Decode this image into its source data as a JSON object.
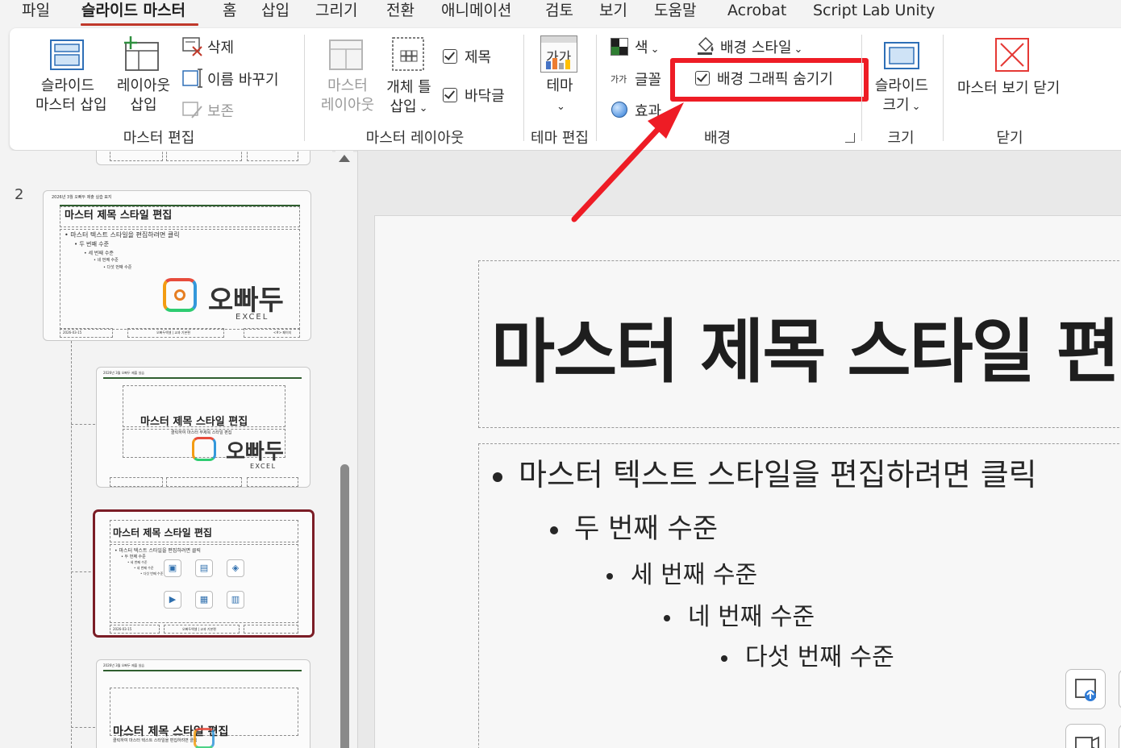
{
  "menu": {
    "tabs": [
      {
        "label": "파일",
        "active": false
      },
      {
        "label": "슬라이드 마스터",
        "active": true
      },
      {
        "label": "홈",
        "active": false
      },
      {
        "label": "삽입",
        "active": false
      },
      {
        "label": "그리기",
        "active": false
      },
      {
        "label": "전환",
        "active": false
      },
      {
        "label": "애니메이션",
        "active": false
      },
      {
        "label": "검토",
        "active": false
      },
      {
        "label": "보기",
        "active": false
      },
      {
        "label": "도움말",
        "active": false
      },
      {
        "label": "Acrobat",
        "active": false
      },
      {
        "label": "Script Lab Unity",
        "active": false
      }
    ],
    "active_underline_color": "#c0392b"
  },
  "ribbon": {
    "master_edit": {
      "insert_master_line1": "슬라이드",
      "insert_master_line2": "마스터 삽입",
      "insert_layout_line1": "레이아웃",
      "insert_layout_line2": "삽입",
      "delete": "삭제",
      "rename": "이름 바꾸기",
      "preserve": "보존",
      "group_label": "마스터 편집"
    },
    "master_layout": {
      "master_layout_line1": "마스터",
      "master_layout_line2": "레이아웃",
      "placeholder_line1": "개체 틀",
      "placeholder_line2": "삽입",
      "title_check": "제목",
      "footer_check": "바닥글",
      "group_label": "마스터 레이아웃",
      "title_checked": true,
      "footer_checked": true
    },
    "theme_edit": {
      "theme_icon_text": "가가",
      "theme": "테마",
      "group_label": "테마 편집"
    },
    "background": {
      "colors": "색",
      "fonts_icon_text": "가가",
      "fonts": "글꼴",
      "effects": "효과",
      "background_styles": "배경 스타일",
      "hide_background_graphics": "배경 그래픽 숨기기",
      "hide_background_graphics_checked": true,
      "group_label": "배경"
    },
    "size": {
      "slide_size_line1": "슬라이드",
      "slide_size_line2": "크기",
      "group_label": "크기"
    },
    "close": {
      "close_master_view": "마스터 보기 닫기",
      "group_label": "닫기"
    }
  },
  "annotation": {
    "highlight_color": "#ee1c25"
  },
  "thumbnails": {
    "slide_number": "2",
    "master": {
      "header_tiny": "2026년 3월 오빠두 제출 실습 표지",
      "title": "마스터 제목 스타일 편집",
      "bullets": [
        "• 마스터 텍스트 스타일을 편집하려면 클릭",
        "• 두 번째 수준",
        "• 세 번째 수준",
        "• 네 번째 수준",
        "• 다섯 번째 수준"
      ],
      "logo_text": "오빠두",
      "logo_sub": "EXCEL",
      "footer_date": "2026-03-15",
      "footer_center": "오빠두엑셀 | 교과 기본편",
      "footer_page": "<#> 페이지"
    },
    "title_layout": {
      "header_tiny": "2026년 3월 오빠두 제출 실습",
      "title": "마스터 제목 스타일 편집",
      "subtitle": "클릭하여 마스터 부제목 스타일 편집",
      "logo_text": "오빠두",
      "logo_sub": "EXCEL"
    },
    "content_layout": {
      "title": "마스터 제목 스타일 편집",
      "bullets": [
        "• 마스터 텍스트 스타일을 편집하려면 클릭",
        "• 두 번째 수준",
        "• 세 번째 수준",
        "• 네 번째 수준",
        "• 다섯 번째 수준"
      ],
      "footer_date": "2026-03-15",
      "footer_center": "오빠두엑셀 | 교과 기본편"
    },
    "section_layout": {
      "header_tiny": "2026년 3월 오빠두 제출 실습",
      "title": "마스터 제목 스타일 편집",
      "subtitle": "클릭하여 마스터 텍스트 스타일을 편집하려면 클릭"
    }
  },
  "slide": {
    "title": "마스터 제목 스타일 편집",
    "bullets": [
      {
        "level": 1,
        "text": "마스터 텍스트 스타일을 편집하려면 클릭"
      },
      {
        "level": 2,
        "text": "두 번째 수준"
      },
      {
        "level": 3,
        "text": "세 번째 수준"
      },
      {
        "level": 4,
        "text": "네 번째 수준"
      },
      {
        "level": 5,
        "text": "다섯 번째 수준"
      }
    ]
  },
  "colors": {
    "selected_thumb_border": "#7b1d26",
    "thumb_title_line": "#2f5e2f"
  }
}
